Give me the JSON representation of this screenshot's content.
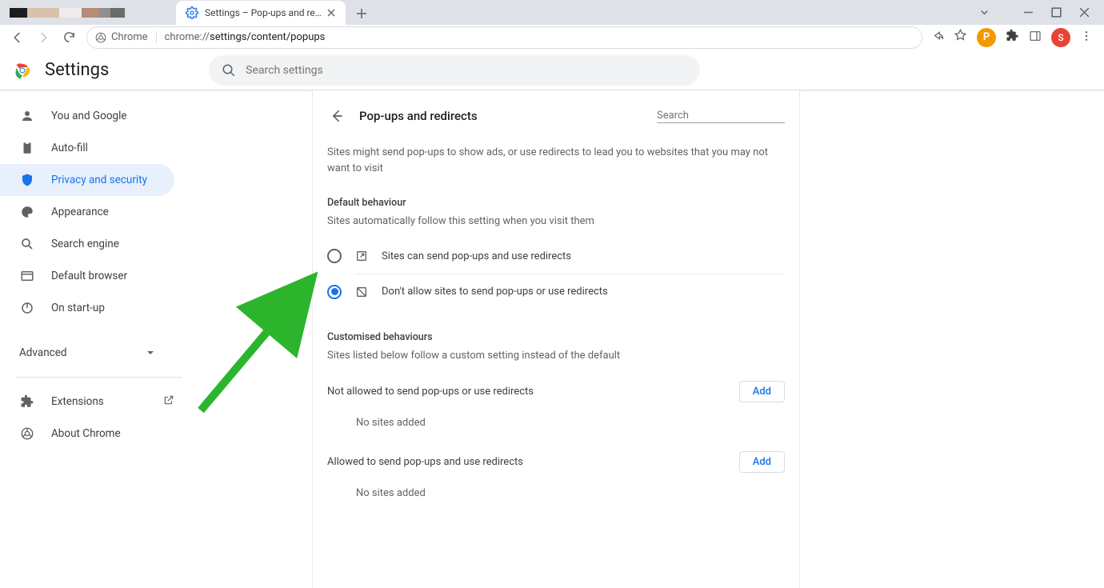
{
  "tabs": {
    "active_title": "Settings – Pop-ups and redirects"
  },
  "omnibox": {
    "chip": "Chrome",
    "url_prefix": "chrome://",
    "url_path": "settings/content/popups"
  },
  "avatar_letter": "S",
  "settings_header": {
    "title": "Settings",
    "search_placeholder": "Search settings"
  },
  "sidebar": {
    "items": [
      {
        "label": "You and Google"
      },
      {
        "label": "Auto-fill"
      },
      {
        "label": "Privacy and security"
      },
      {
        "label": "Appearance"
      },
      {
        "label": "Search engine"
      },
      {
        "label": "Default browser"
      },
      {
        "label": "On start-up"
      }
    ],
    "advanced": "Advanced",
    "extensions": "Extensions",
    "about": "About Chrome"
  },
  "page": {
    "title": "Pop-ups and redirects",
    "search_placeholder": "Search",
    "description": "Sites might send pop-ups to show ads, or use redirects to lead you to websites that you may not want to visit",
    "default_behaviour_title": "Default behaviour",
    "default_behaviour_sub": "Sites automatically follow this setting when you visit them",
    "option_allow": "Sites can send pop-ups and use redirects",
    "option_block": "Don't allow sites to send pop-ups or use redirects",
    "custom_title": "Customised behaviours",
    "custom_sub": "Sites listed below follow a custom setting instead of the default",
    "not_allowed_label": "Not allowed to send pop-ups or use redirects",
    "allowed_label": "Allowed to send pop-ups and use redirects",
    "add_button": "Add",
    "no_sites": "No sites added"
  }
}
